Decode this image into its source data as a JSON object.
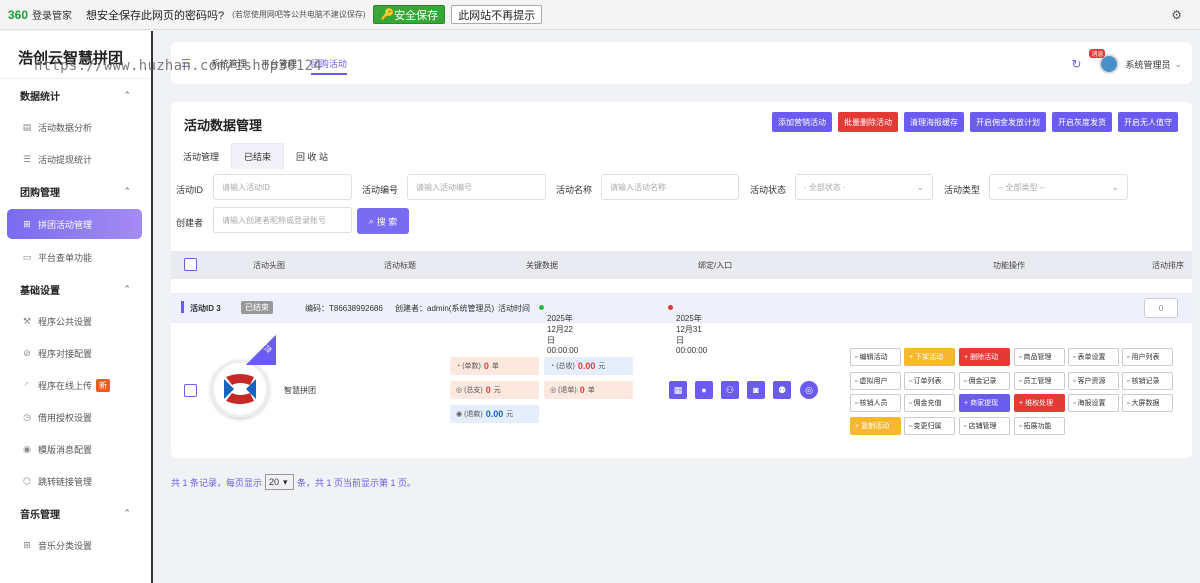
{
  "password_bar": {
    "logo": "360",
    "name": "登录管家",
    "question": "想安全保存此网页的密码吗?",
    "note": "(若您使用网吧等公共电脑不建议保存)",
    "save_label": "安全保存",
    "never_label": "此网站不再提示"
  },
  "watermark": "https://www.huzhan.com/ishop30124",
  "sidebar": {
    "brand": "浩创云智慧拼团",
    "groups": [
      {
        "label": "数据统计",
        "items": [
          {
            "label": "活动数据分析",
            "icon": "chart-icon"
          },
          {
            "label": "活动提现统计",
            "icon": "list-icon"
          }
        ]
      },
      {
        "label": "团购管理",
        "items": [
          {
            "label": "拼团活动管理",
            "icon": "group-icon",
            "active": true
          },
          {
            "label": "平台查单功能",
            "icon": "folder-icon"
          }
        ]
      },
      {
        "label": "基础设置",
        "items": [
          {
            "label": "程序公共设置",
            "icon": "tools-icon"
          },
          {
            "label": "程序对接配置",
            "icon": "compass-icon"
          },
          {
            "label": "程序在线上传",
            "icon": "rss-icon",
            "badge": "新"
          },
          {
            "label": "借用授权设置",
            "icon": "clock-icon"
          },
          {
            "label": "模版消息配置",
            "icon": "message-icon"
          },
          {
            "label": "跳转链接管理",
            "icon": "link-icon"
          }
        ]
      },
      {
        "label": "音乐管理",
        "items": [
          {
            "label": "音乐分类设置",
            "icon": "grid-icon"
          }
        ]
      }
    ]
  },
  "topbar": {
    "crumbs": [
      "系统管理",
      "平台管理",
      "团购活动"
    ],
    "badge": "消息",
    "user": "系统管理员"
  },
  "card": {
    "title": "活动数据管理",
    "actions": [
      "添加营销活动",
      "批量删除活动",
      "清理海报缓存",
      "开启佣金发放计划",
      "开启灰度发货",
      "开启无人值守"
    ],
    "tabs": [
      "活动管理",
      "已结束",
      "回 收 站"
    ],
    "filters": {
      "id_label": "活动ID",
      "id_ph": "请输入活动ID",
      "no_label": "活动编号",
      "no_ph": "请输入活动编号",
      "name_label": "活动名称",
      "name_ph": "请输入活动名称",
      "status_label": "活动状态",
      "status_val": "- 全部状态 -",
      "type_label": "活动类型",
      "type_val": "-- 全部类型 --",
      "creator_label": "创建者",
      "creator_ph": "请输入创建者昵称或登录账号",
      "search_label": "搜 索"
    },
    "columns": [
      "活动头图",
      "活动标题",
      "关键数据",
      "绑定/入口",
      "功能操作",
      "活动排序"
    ],
    "row": {
      "id_text": "活动ID 3",
      "status": "已结束",
      "code": "编码：T86638992686",
      "creator": "创建者：admin(系统管理员)",
      "time_label": "活动时间",
      "start": "2025年12月22日 00:00:00",
      "end": "2025年12月31日 00:00:00",
      "sort": "0",
      "ribbon": "置顶",
      "name": "智慧拼团",
      "stats": {
        "orders_label": "(单数)",
        "orders": "0",
        "orders_unit": "单",
        "income_label": "(总收)",
        "income": "0.00",
        "income_unit": "元",
        "expense_label": "(总支)",
        "expense": "0",
        "expense_unit": "元",
        "refund_orders_label": "(退单)",
        "refund_orders": "0",
        "refund_orders_unit": "单",
        "refund_label": "(退款)",
        "refund": "0.00",
        "refund_unit": "元"
      },
      "entry_icons": [
        "qrcode-icon",
        "user-icon",
        "users-icon",
        "mini-program-icon",
        "team-icon",
        "circle-icon"
      ],
      "functions": [
        [
          "编辑活动",
          "下架活动",
          "删除活动",
          "商品管理",
          "表单设置",
          "用户列表"
        ],
        [
          "虚拟用户",
          "订单列表",
          "佣金记录",
          "员工管理",
          "客户资源",
          "核销记录"
        ],
        [
          "核销人员",
          "佣金充值",
          "商家提现",
          "维权处理",
          "海报设置",
          "大屏数据"
        ],
        [
          "复制活动",
          "变更归属",
          "店铺管理",
          "拓展功能"
        ]
      ]
    }
  },
  "pager": {
    "prefix": "共 1 条记录，每页显示",
    "size": "20",
    "suffix": "条，共 1 页当前显示第 1 页。"
  }
}
